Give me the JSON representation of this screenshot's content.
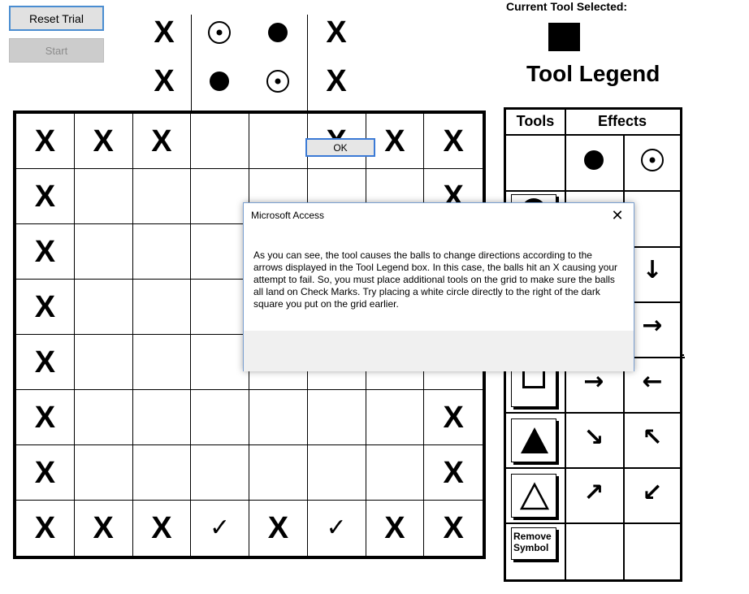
{
  "controls": {
    "reset_label": "Reset Trial",
    "start_label": "Start"
  },
  "header_symbols": {
    "row1": [
      "X",
      "target",
      "dot",
      "X"
    ],
    "row2": [
      "X",
      "dot",
      "target",
      "X"
    ]
  },
  "current_tool": {
    "label": "Current Tool Selected:",
    "tool": "black-square"
  },
  "legend": {
    "title": "Tool Legend",
    "col_tools": "Tools",
    "col_effects": "Effects",
    "remove_label": "Remove\nSymbol",
    "rows": [
      {
        "tool": "none",
        "effect_a": "dot",
        "effect_b": "target"
      },
      {
        "tool": "dark-circle",
        "effect_a": "",
        "effect_b": ""
      },
      {
        "tool": "hidden",
        "effect_a": "",
        "effect_b": "↓"
      },
      {
        "tool": "hidden",
        "effect_a": "",
        "effect_b": "→"
      },
      {
        "tool": "white-square",
        "effect_a": "→",
        "effect_b": "←"
      },
      {
        "tool": "black-triangle",
        "effect_a": "↘",
        "effect_b": "↖"
      },
      {
        "tool": "white-triangle",
        "effect_a": "↗",
        "effect_b": "↙"
      },
      {
        "tool": "remove-symbol",
        "effect_a": "",
        "effect_b": ""
      }
    ]
  },
  "grid": [
    [
      "X",
      "X",
      "X",
      "",
      "",
      "X",
      "X",
      "X"
    ],
    [
      "X",
      "",
      "",
      "",
      "",
      "",
      "",
      "X"
    ],
    [
      "X",
      "",
      "",
      "",
      "",
      "",
      "",
      ""
    ],
    [
      "X",
      "",
      "",
      "",
      "",
      "",
      "",
      ""
    ],
    [
      "X",
      "",
      "",
      "",
      "",
      "",
      "",
      ""
    ],
    [
      "X",
      "",
      "",
      "",
      "",
      "",
      "",
      "X"
    ],
    [
      "X",
      "",
      "",
      "",
      "",
      "",
      "",
      "X"
    ],
    [
      "X",
      "X",
      "X",
      "✓",
      "X",
      "✓",
      "X",
      "X"
    ]
  ],
  "dialog": {
    "title": "Microsoft Access",
    "close": "✕",
    "message": "As you can see, the tool causes the balls to change directions according to the arrows displayed in the Tool Legend box.  In this case, the balls hit an X causing your attempt to fail.  So, you must place additional tools on the grid to make sure the balls all land on Check Marks. Try placing a white circle directly to the right of the dark square you put on the grid earlier.",
    "ok_label": "OK"
  }
}
